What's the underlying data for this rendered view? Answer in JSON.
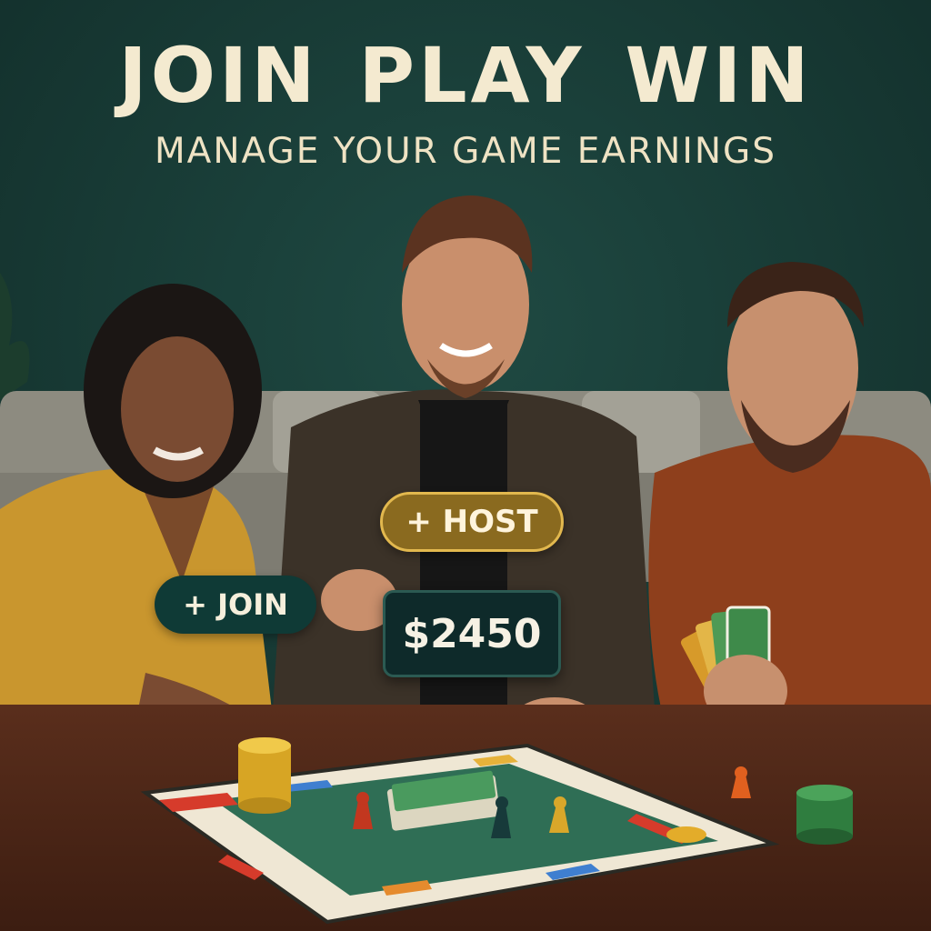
{
  "headline": {
    "word1": "JOIN",
    "word2": "PLAY",
    "word3": "WIN"
  },
  "subheadline": "MANAGE YOUR GAME EARNINGS",
  "buttons": {
    "host": "+ HOST",
    "join": "+ JOIN"
  },
  "balance": "$2450",
  "colors": {
    "background_wall": "#173a35",
    "headline_text": "#f4ead0",
    "host_button": "#8a6a1f",
    "host_border": "#e2b84e",
    "join_button": "#0f3a36",
    "balance_panel": "#0e2a2a"
  }
}
